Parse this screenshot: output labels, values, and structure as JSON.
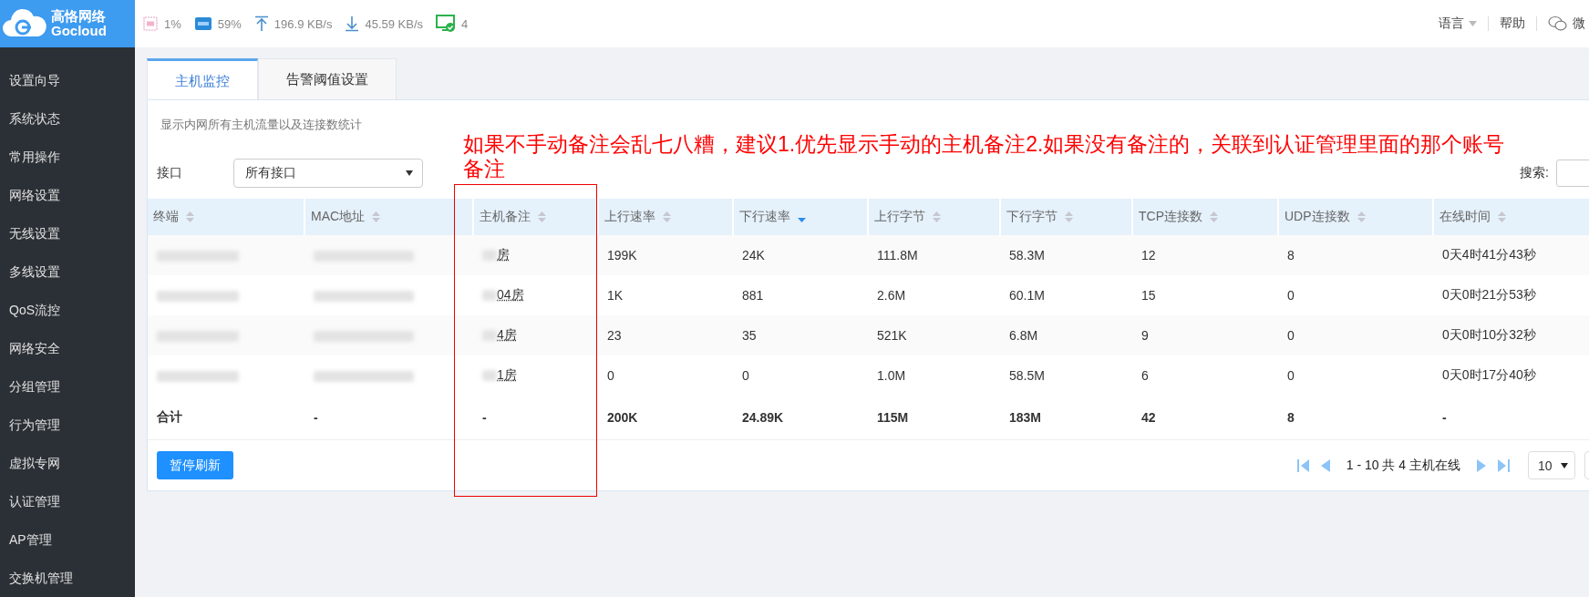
{
  "logo": {
    "name": "高恪网络",
    "brand": "Gocloud"
  },
  "status": {
    "cpu": "1%",
    "ram": "59%",
    "upload": "196.9 KB/s",
    "download": "45.59 KB/s",
    "online": "4"
  },
  "top_links": [
    {
      "kind": "dropdown",
      "label": "语言"
    },
    {
      "kind": "link",
      "label": "帮助"
    },
    {
      "kind": "wechat",
      "label": "微"
    }
  ],
  "sidebar": {
    "items": [
      {
        "label": "设置向导",
        "selected": false
      },
      {
        "label": "系统状态",
        "selected": false
      },
      {
        "label": "常用操作",
        "selected": false
      },
      {
        "label": "网络设置",
        "selected": false
      },
      {
        "label": "无线设置",
        "selected": false
      },
      {
        "label": "多线设置",
        "selected": false
      },
      {
        "label": "QoS流控",
        "selected": false
      },
      {
        "label": "网络安全",
        "selected": false
      },
      {
        "label": "分组管理",
        "selected": false
      },
      {
        "label": "行为管理",
        "selected": false
      },
      {
        "label": "虚拟专网",
        "selected": false
      },
      {
        "label": "认证管理",
        "selected": false
      },
      {
        "label": "AP管理",
        "selected": false
      },
      {
        "label": "交换机管理",
        "selected": false
      }
    ]
  },
  "tabs": [
    {
      "label": "主机监控",
      "selected": true
    },
    {
      "label": "告警阈值设置",
      "selected": false
    }
  ],
  "description": "显示内网所有主机流量以及连接数统计",
  "interface": {
    "label": "接口",
    "value": "所有接口"
  },
  "search": {
    "label": "搜索:"
  },
  "annotation": "如果不手动备注会乱七八糟，建议1.优先显示手动的主机备注2.如果没有备注的，关联到认证管理里面的那个账号备注",
  "table": {
    "columns": [
      {
        "label": "终端",
        "sorted": false
      },
      {
        "label": "MAC地址",
        "sorted": false
      },
      {
        "label": "主机备注",
        "sorted": false
      },
      {
        "label": "上行速率",
        "sorted": false
      },
      {
        "label": "下行速率",
        "sorted": true
      },
      {
        "label": "上行字节",
        "sorted": false
      },
      {
        "label": "下行字节",
        "sorted": false
      },
      {
        "label": "TCP连接数",
        "sorted": false
      },
      {
        "label": "UDP连接数",
        "sorted": false
      },
      {
        "label": "在线时间",
        "sorted": false
      }
    ],
    "rows": [
      {
        "cells": [
          {
            "kind": "blurred"
          },
          {
            "kind": "blurred"
          },
          {
            "kind": "note",
            "text": "房"
          },
          {
            "kind": "text",
            "text": "199K"
          },
          {
            "kind": "text",
            "text": "24K"
          },
          {
            "kind": "text",
            "text": "111.8M"
          },
          {
            "kind": "text",
            "text": "58.3M"
          },
          {
            "kind": "text",
            "text": "12"
          },
          {
            "kind": "text",
            "text": "8"
          },
          {
            "kind": "text",
            "text": "0天4时41分43秒"
          }
        ]
      },
      {
        "cells": [
          {
            "kind": "blurred"
          },
          {
            "kind": "blurred"
          },
          {
            "kind": "note",
            "text": "04房"
          },
          {
            "kind": "text",
            "text": "1K"
          },
          {
            "kind": "text",
            "text": "881"
          },
          {
            "kind": "text",
            "text": "2.6M"
          },
          {
            "kind": "text",
            "text": "60.1M"
          },
          {
            "kind": "text",
            "text": "15"
          },
          {
            "kind": "text",
            "text": "0"
          },
          {
            "kind": "text",
            "text": "0天0时21分53秒"
          }
        ]
      },
      {
        "cells": [
          {
            "kind": "blurred"
          },
          {
            "kind": "blurred"
          },
          {
            "kind": "note",
            "text": "4房"
          },
          {
            "kind": "text",
            "text": "23"
          },
          {
            "kind": "text",
            "text": "35"
          },
          {
            "kind": "text",
            "text": "521K"
          },
          {
            "kind": "text",
            "text": "6.8M"
          },
          {
            "kind": "text",
            "text": "9"
          },
          {
            "kind": "text",
            "text": "0"
          },
          {
            "kind": "text",
            "text": "0天0时10分32秒"
          }
        ]
      },
      {
        "cells": [
          {
            "kind": "blurred"
          },
          {
            "kind": "blurred"
          },
          {
            "kind": "note",
            "text": "1房"
          },
          {
            "kind": "text",
            "text": "0"
          },
          {
            "kind": "text",
            "text": "0"
          },
          {
            "kind": "text",
            "text": "1.0M"
          },
          {
            "kind": "text",
            "text": "58.5M"
          },
          {
            "kind": "text",
            "text": "6"
          },
          {
            "kind": "text",
            "text": "0"
          },
          {
            "kind": "text",
            "text": "0天0时17分40秒"
          }
        ]
      }
    ],
    "total": [
      "合计",
      "-",
      "-",
      "200K",
      "24.89K",
      "115M",
      "183M",
      "42",
      "8",
      "-"
    ]
  },
  "pause_button": "暂停刷新",
  "pagination": {
    "summary": "1 - 10 共 4 主机在线",
    "page_size": "10"
  }
}
